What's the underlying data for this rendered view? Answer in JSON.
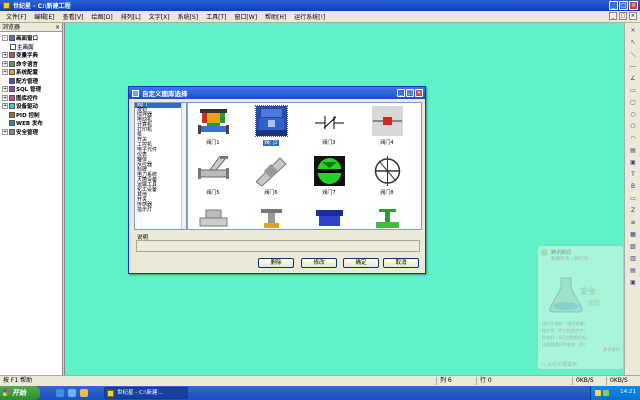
{
  "window": {
    "title": "世纪星 - C:\\新建工程"
  },
  "menu": [
    "文件[F]",
    "编辑[E]",
    "查看[V]",
    "绘图[D]",
    "排列[L]",
    "文字[X]",
    "系统[S]",
    "工具[T]",
    "窗口[W]",
    "帮助[H]",
    "运行系统[!]"
  ],
  "browser": {
    "title": "浏览器",
    "items": [
      {
        "label": "画面窗口",
        "expander": "-",
        "selected": false,
        "indent": 0
      },
      {
        "label": "主画面",
        "expander": "",
        "selected": true,
        "indent": 1
      },
      {
        "label": "变量字典",
        "expander": "+",
        "selected": false,
        "indent": 0
      },
      {
        "label": "命令语言",
        "expander": "+",
        "selected": false,
        "indent": 0
      },
      {
        "label": "系统配置",
        "expander": "+",
        "selected": false,
        "indent": 0
      },
      {
        "label": "配方管理",
        "expander": "",
        "selected": false,
        "indent": 0
      },
      {
        "label": "SQL 管理",
        "expander": "+",
        "selected": false,
        "indent": 0
      },
      {
        "label": "图库控件",
        "expander": "+",
        "selected": false,
        "indent": 0
      },
      {
        "label": "设备驱动",
        "expander": "+",
        "selected": false,
        "indent": 0
      },
      {
        "label": "PID 控制",
        "expander": "",
        "selected": false,
        "indent": 0
      },
      {
        "label": "WEB 发布",
        "expander": "",
        "selected": false,
        "indent": 0
      },
      {
        "label": "安全管理",
        "expander": "+",
        "selected": false,
        "indent": 0
      }
    ]
  },
  "dialog": {
    "title": "自定义图库选择",
    "categories": [
      "阀门",
      "按钮",
      "搅拌器",
      "电动机",
      "计算机",
      "打印机",
      "泵",
      "开关",
      "工控机",
      "电子元件",
      "仪表",
      "罐体",
      "反应器",
      "标牌",
      "电力系统",
      "灭菌设备",
      "运输工具",
      "化工设备",
      "其他",
      "开关",
      "传感器",
      "指示灯"
    ],
    "selected_category": 0,
    "images": [
      {
        "label": "阀门1",
        "kind": "valve-gate-color"
      },
      {
        "label": "阀门2",
        "kind": "valve-blue",
        "selected": true
      },
      {
        "label": "阀门3",
        "kind": "valve-line"
      },
      {
        "label": "阀门4",
        "kind": "valve-red-box"
      },
      {
        "label": "阀门5",
        "kind": "valve-y-flange"
      },
      {
        "label": "阀门6",
        "kind": "valve-diagonal"
      },
      {
        "label": "阀门7",
        "kind": "valve-green-ball"
      },
      {
        "label": "阀门8",
        "kind": "valve-butterfly"
      },
      {
        "label": "",
        "kind": "valve-partial-1"
      },
      {
        "label": "",
        "kind": "valve-partial-2"
      },
      {
        "label": "",
        "kind": "valve-partial-3"
      },
      {
        "label": "",
        "kind": "valve-partial-4"
      }
    ],
    "desc_label": "说明",
    "buttons": {
      "delete": "删除",
      "modify": "修改",
      "ok": "确定",
      "cancel": "取消"
    }
  },
  "balloon": {
    "title": "腾讯新闻",
    "subtitle": "新闻热点 一网打尽",
    "brand1": "安全",
    "brand2": "保障",
    "lines": [
      "用户至最新（请点提醒）",
      "维护案（IP工程维护中）",
      "那样好（SO公需提前先）",
      "迅腾是最好的软件（那）"
    ],
    "more": "更多资讯",
    "no_more": "以后不再提示"
  },
  "status": {
    "help": "按 F1 帮助",
    "col": "列 6",
    "row": "行 0",
    "speed1": "0KB/S",
    "speed2": "0KB/S"
  },
  "taskbar": {
    "start": "开始",
    "task": "世纪星 - C:\\新建...",
    "clock": "14:21"
  }
}
